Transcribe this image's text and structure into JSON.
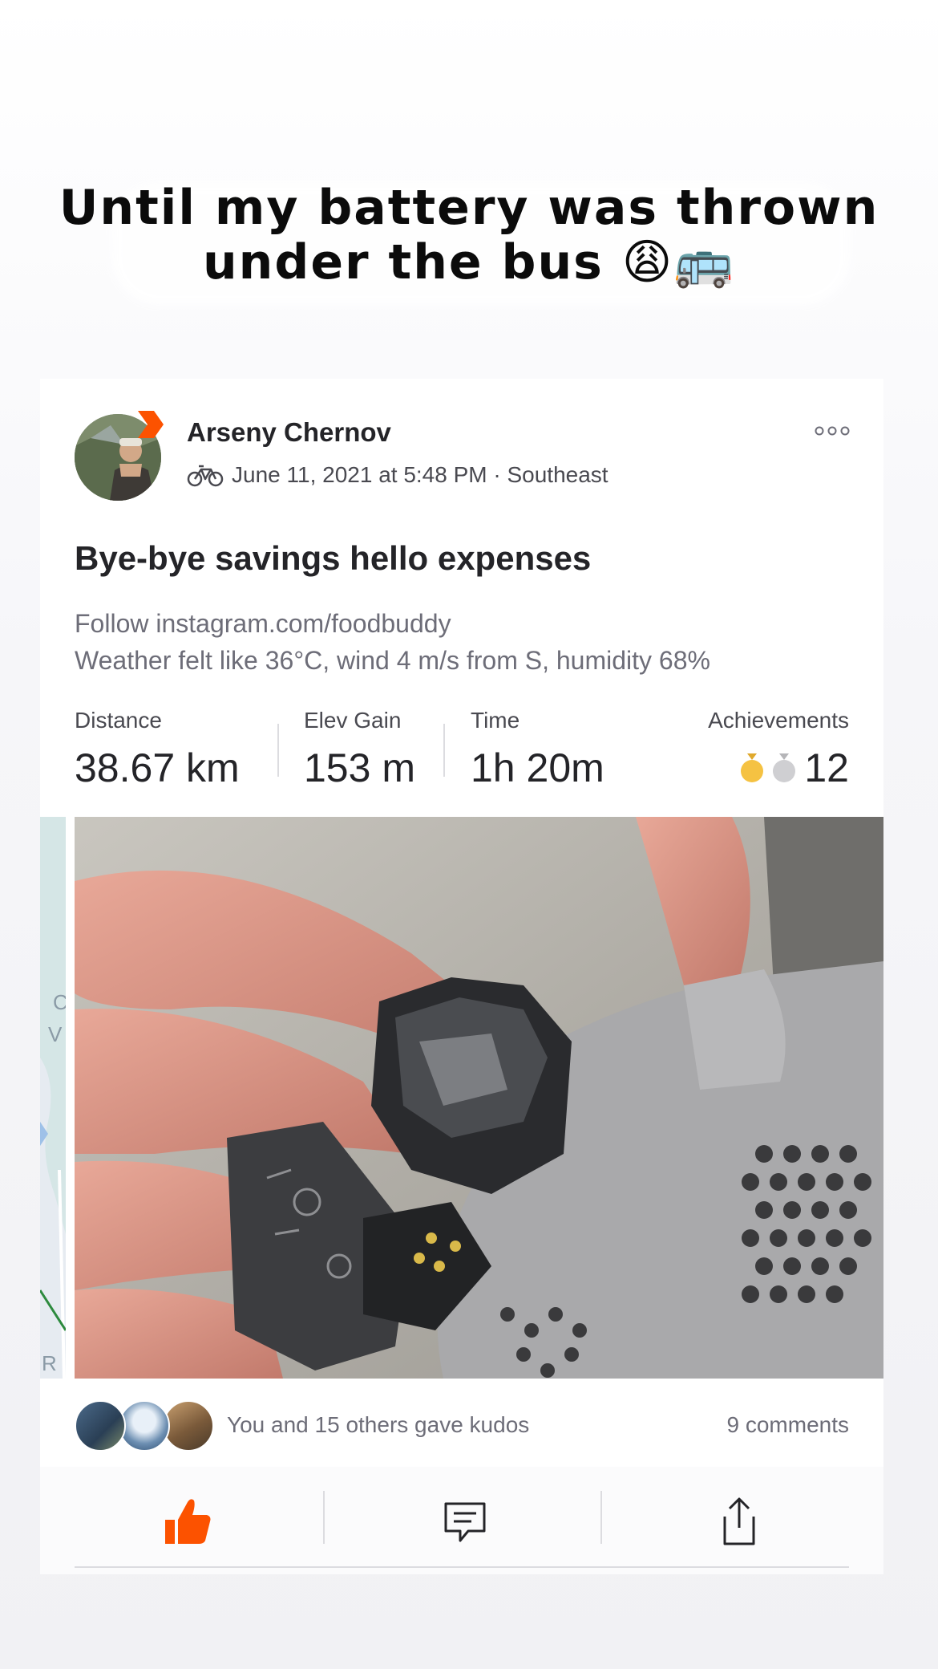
{
  "story_caption": {
    "line1": "Until my battery was thrown",
    "line2": "under the bus",
    "emojis": "😩🚌"
  },
  "post": {
    "athlete_name": "Arseny Chernov",
    "activity_icon": "bike-icon",
    "meta": "June 11, 2021 at 5:48 PM · Southeast",
    "title": "Bye-bye savings hello expenses",
    "description_lines": [
      "Follow instagram.com/foodbuddy",
      "Weather felt like 36°C, wind 4 m/s from S, humidity 68%"
    ],
    "stats": [
      {
        "label": "Distance",
        "value": "38.67 km"
      },
      {
        "label": "Elev Gain",
        "value": "153 m"
      },
      {
        "label": "Time",
        "value": "1h 20m"
      }
    ],
    "achievements": {
      "label": "Achievements",
      "count": "12",
      "medal_colors": [
        "#f5c242",
        "#cfcfd2"
      ]
    },
    "kudos_text": "You and 15 others gave kudos",
    "comments_text": "9 comments"
  },
  "colors": {
    "brand": "#fc5200",
    "text_primary": "#242428",
    "text_secondary": "#6d6d78"
  }
}
